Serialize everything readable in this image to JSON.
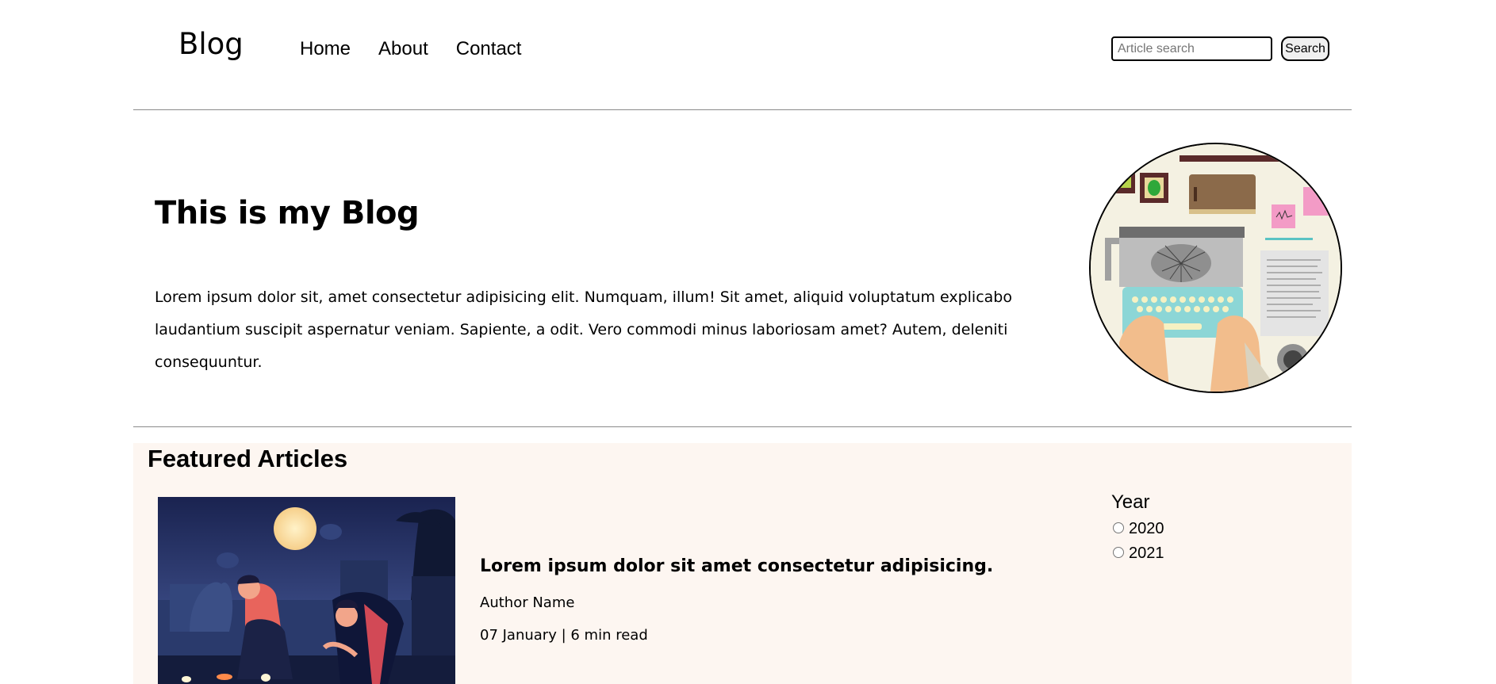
{
  "header": {
    "logo": "Blog",
    "nav": [
      "Home",
      "About",
      "Contact"
    ],
    "search_placeholder": "Article search",
    "search_button": "Search"
  },
  "hero": {
    "title": "This is my Blog",
    "text": "Lorem ipsum dolor sit, amet consectetur adipisicing elit. Numquam, illum! Sit amet, aliquid voluptatum explicabo laudantium suscipit aspernatur veniam. Sapiente, a odit. Vero commodi minus laboriosam amet? Autem, deleniti consequuntur."
  },
  "featured": {
    "title": "Featured Articles",
    "article": {
      "title": "Lorem ipsum dolor sit amet consectetur adipisicing.",
      "author": "Author Name",
      "meta": "07 January | 6 min read"
    },
    "filter": {
      "title": "Year",
      "options": [
        "2020",
        "2021"
      ]
    }
  }
}
